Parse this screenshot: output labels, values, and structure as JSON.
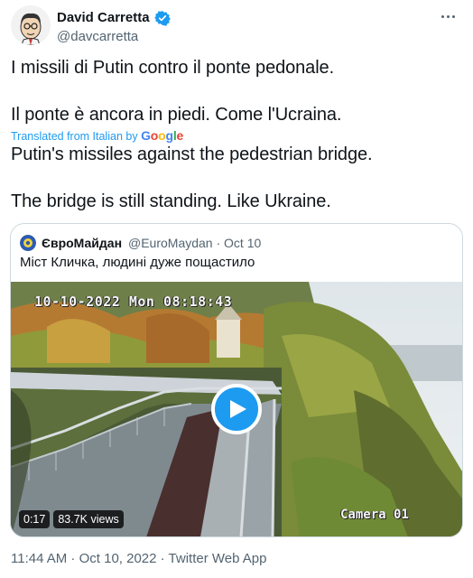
{
  "author": {
    "name": "David Carretta",
    "handle": "@davcarretta",
    "avatar_icon": "caricature-avatar-icon",
    "verified_icon": "verified-badge-icon"
  },
  "tweet": {
    "original_lines": [
      "I missili di Putin contro il ponte pedonale.",
      "Il ponte è ancora in piedi. Come l'Ucraina."
    ],
    "translation_label": "Translated from Italian by",
    "translation_brand": "Google",
    "translated_lines": [
      "Putin's missiles against the pedestrian bridge.",
      "The bridge is still standing. Like Ukraine."
    ]
  },
  "quote": {
    "name": "ЄвроМайдан",
    "meta": "@EuroMaydan · Oct 10",
    "text": "Міст Кличка, людині дуже пощастило",
    "video": {
      "osd_timestamp": "10-10-2022 Mon 08:18:43",
      "osd_camera": "Camera 01",
      "duration": "0:17",
      "views": "83.7K views"
    }
  },
  "footer": {
    "meta": "11:44 AM · Oct 10, 2022 · Twitter Web App"
  },
  "colors": {
    "accent": "#1d9bf0",
    "text_primary": "#0f1419",
    "text_secondary": "#536471",
    "border": "#cfd9de"
  }
}
